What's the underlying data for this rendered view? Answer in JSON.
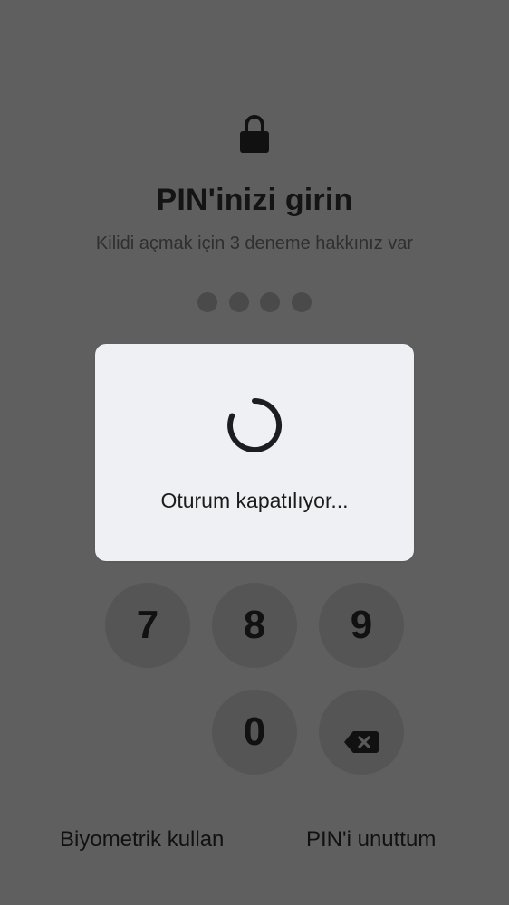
{
  "screen": {
    "title": "PIN'inizi girin",
    "subtitle": "Kilidi açmak için 3 deneme hakkınız var",
    "pin_dots_count": 4,
    "icons": {
      "lock": "lock-icon",
      "backspace": "backspace-icon",
      "spinner": "loading-spinner-icon"
    }
  },
  "keypad": {
    "row1": [
      "7",
      "8",
      "9"
    ],
    "row2": [
      "0"
    ]
  },
  "actions": {
    "biometric": "Biyometrik kullan",
    "forgot_pin": "PIN'i unuttum"
  },
  "dialog": {
    "message": "Oturum kapatılıyor..."
  },
  "colors": {
    "overlay_background": "#5f5f5f",
    "dialog_background": "#eff0f4",
    "key_background": "#555555",
    "pin_dot": "#4a4a4a",
    "text_primary": "#111111"
  }
}
